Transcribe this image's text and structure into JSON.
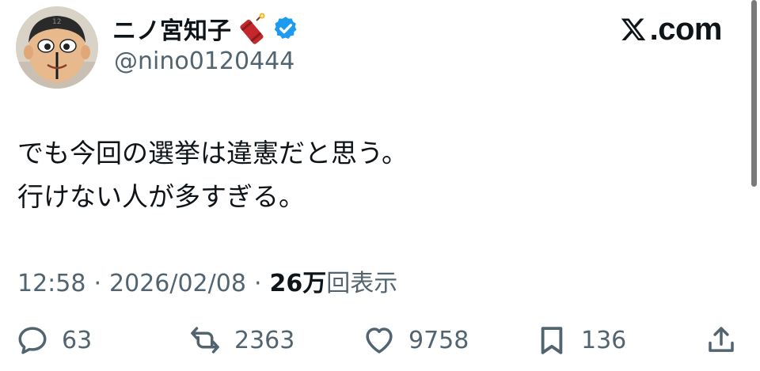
{
  "user": {
    "display_name": "ニノ宮知子",
    "handle": "@nino0120444",
    "name_emoji": "firecracker-emoji",
    "verified_color": "#1d9bf0"
  },
  "brand": {
    "text": ".com",
    "logo": "x-logo-icon"
  },
  "tweet": {
    "lines": [
      "でも今回の選挙は違憲だと思う。",
      "行けない人が多すぎる。"
    ]
  },
  "meta": {
    "time": "12:58",
    "separator": "·",
    "date": "2026/02/08",
    "views_count": "26万",
    "views_label": "回表示"
  },
  "actions": {
    "replies": {
      "icon": "reply-icon",
      "count": "63"
    },
    "retweets": {
      "icon": "retweet-icon",
      "count": "2363"
    },
    "likes": {
      "icon": "heart-icon",
      "count": "9758"
    },
    "bookmarks": {
      "icon": "bookmark-icon",
      "count": "136"
    },
    "share": {
      "icon": "share-icon"
    }
  },
  "colors": {
    "text_primary": "#0f1419",
    "text_secondary": "#536471",
    "accent": "#1d9bf0"
  }
}
